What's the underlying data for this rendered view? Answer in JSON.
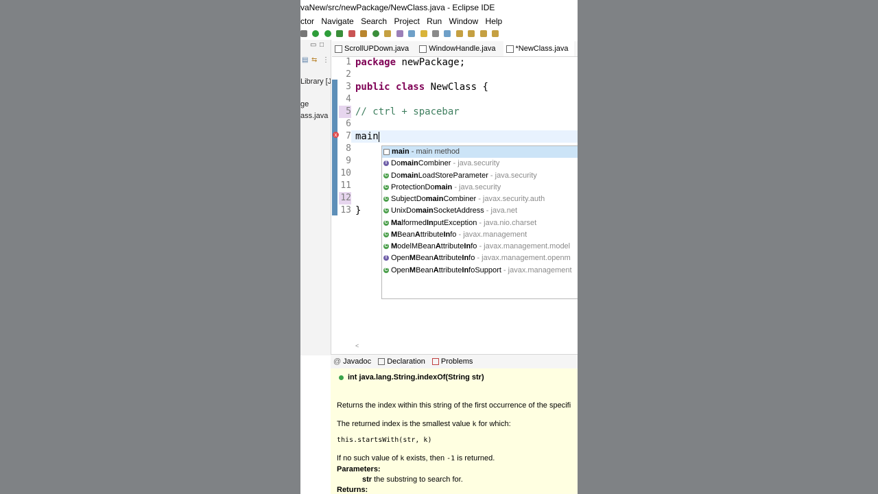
{
  "window": {
    "title": "vaNew/src/newPackage/NewClass.java - Eclipse IDE"
  },
  "menu": [
    "ctor",
    "Navigate",
    "Search",
    "Project",
    "Run",
    "Window",
    "Help"
  ],
  "left_panel": {
    "items": [
      "Library [Ja",
      "ge",
      "ass.java"
    ]
  },
  "editor_tabs": [
    {
      "label": "ScrollUPDown.java",
      "active": false
    },
    {
      "label": "WindowHandle.java",
      "active": false
    },
    {
      "label": "*NewClass.java",
      "active": true
    }
  ],
  "editor": {
    "line_numbers": [
      "1",
      "2",
      "3",
      "4",
      "5",
      "6",
      "7",
      "8",
      "9",
      "10",
      "11",
      "12",
      "13"
    ],
    "line1": {
      "kw": "package",
      "rest": " newPackage;"
    },
    "line3": {
      "kw1": "public",
      "kw2": "class",
      "rest": " NewClass {"
    },
    "line5": {
      "comment": "// ctrl + spacebar"
    },
    "line7": {
      "text": "main"
    },
    "line13": {
      "text": "}"
    }
  },
  "completion": [
    {
      "bold": "main",
      "rest": "",
      "qual": " - main method",
      "icon": "template-icon",
      "selected": true
    },
    {
      "bold": "",
      "name": "DomainCombiner",
      "pre": "Do",
      "mid": "main",
      "post": "Combiner",
      "qual": " - java.security",
      "icon": "interface-icon"
    },
    {
      "pre": "Do",
      "mid": "main",
      "post": "LoadStoreParameter",
      "qual": " - java.security",
      "icon": "class-icon"
    },
    {
      "pre": "ProtectionDo",
      "mid": "main",
      "post": "",
      "qual": " - java.security",
      "icon": "class-icon"
    },
    {
      "pre": "SubjectDo",
      "mid": "main",
      "post": "Combiner",
      "qual": " - javax.security.auth",
      "icon": "class-icon"
    },
    {
      "pre": "UnixDo",
      "mid": "main",
      "post": "SocketAddress",
      "qual": " - java.net",
      "icon": "class-icon"
    },
    {
      "pre": "",
      "mid": "Ma",
      "post": "lformed",
      "mid2": "In",
      "post2": "putException",
      "qual": " - java.nio.charset",
      "icon": "class-icon"
    },
    {
      "pre": "",
      "mid": "M",
      "post": "Bean",
      "mid2": "A",
      "post2": "ttribute",
      "mid3": "In",
      "post3": "fo",
      "qual": " - javax.management",
      "icon": "class-icon"
    },
    {
      "pre": "",
      "mid": "M",
      "post": "odelMBean",
      "mid2": "A",
      "post2": "ttribute",
      "mid3": "In",
      "post3": "fo",
      "qual": " - javax.management.model",
      "icon": "class-icon"
    },
    {
      "pre": "Open",
      "mid": "M",
      "post": "Bean",
      "mid2": "A",
      "post2": "ttribute",
      "mid3": "In",
      "post3": "fo",
      "qual": " - javax.management.openm",
      "icon": "interface-icon"
    },
    {
      "pre": "Open",
      "mid": "M",
      "post": "Bean",
      "mid2": "A",
      "post2": "ttribute",
      "mid3": "In",
      "post3": "foSupport",
      "qual": " - javax.management",
      "icon": "class-icon"
    }
  ],
  "view_tabs": [
    "Javadoc",
    "Declaration",
    "Problems"
  ],
  "javadoc": {
    "signature": "int java.lang.String.indexOf(String str)",
    "desc": "Returns the index within this string of the first occurrence of the specifi",
    "smallest_pre": "The returned index is the smallest value ",
    "smallest_k": "k",
    "smallest_post": " for which:",
    "code": " this.startsWith(str, k)",
    "nosuch_pre": "If no such value of ",
    "nosuch_k": "k",
    "nosuch_mid": " exists, then ",
    "nosuch_val": "-1",
    "nosuch_post": " is returned.",
    "params_label": "Parameters:",
    "param_name": "str",
    "param_desc": " the substring to search for.",
    "returns_label": "Returns:"
  }
}
